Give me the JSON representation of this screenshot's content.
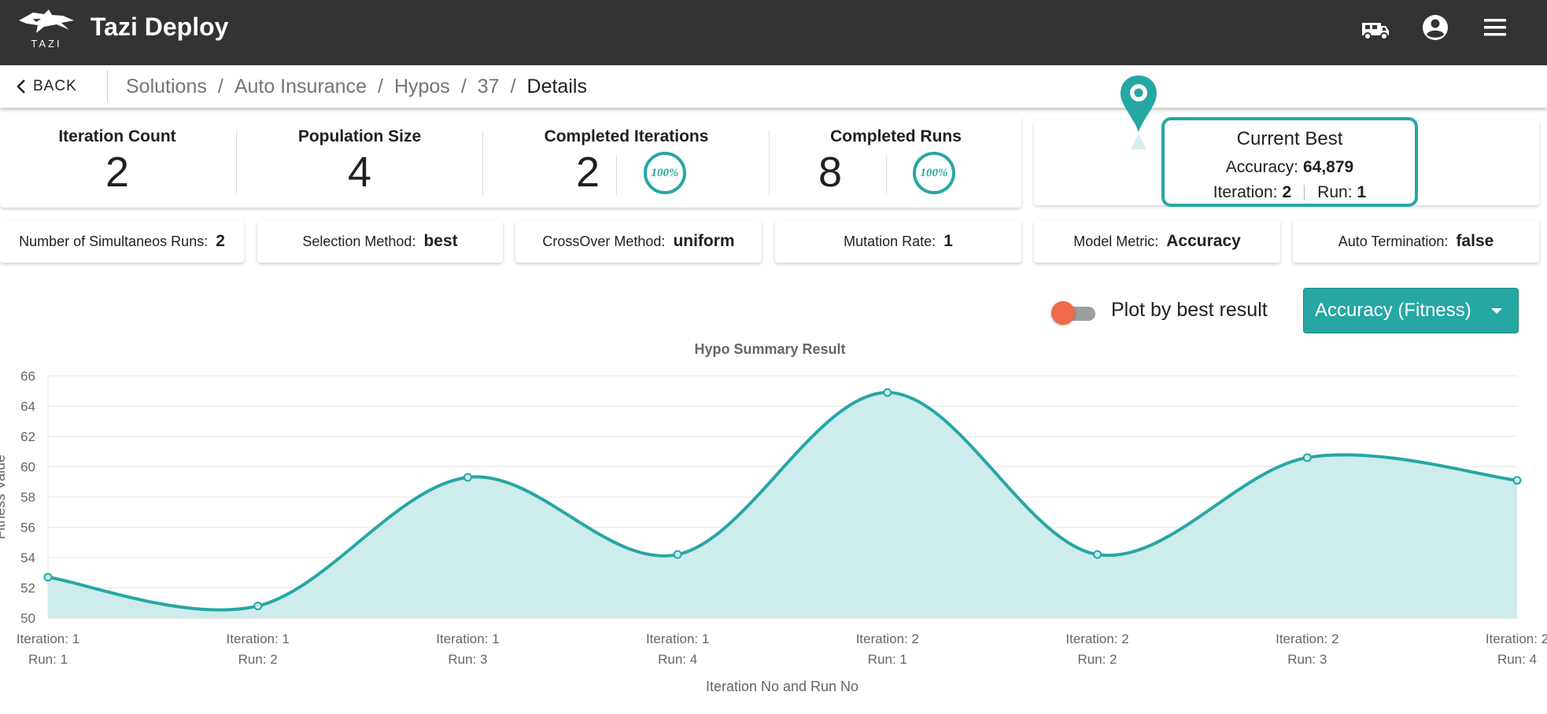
{
  "app": {
    "logo_text": "TAZI",
    "title": "Tazi Deploy"
  },
  "topbar": {
    "icons": [
      "truck-icon",
      "account-circle-icon",
      "menu-icon"
    ]
  },
  "nav": {
    "back_label": "BACK"
  },
  "breadcrumb": {
    "items": [
      "Solutions",
      "Auto Insurance",
      "Hypos",
      "37",
      "Details"
    ]
  },
  "stats": {
    "iteration_count": {
      "label": "Iteration Count",
      "value": "2"
    },
    "population_size": {
      "label": "Population Size",
      "value": "4"
    },
    "completed_iterations": {
      "label": "Completed Iterations",
      "value": "2",
      "progress_label": "100%",
      "progress": 100
    },
    "completed_runs": {
      "label": "Completed Runs",
      "value": "8",
      "progress_label": "100%",
      "progress": 100
    }
  },
  "current_best": {
    "title": "Current Best",
    "accuracy_label": "Accuracy:",
    "accuracy_value": "64,879",
    "iteration_label": "Iteration:",
    "iteration_value": "2",
    "run_label": "Run:",
    "run_value": "1"
  },
  "params": {
    "simultaneous_runs": {
      "label": "Number of Simultaneos Runs:",
      "value": "2"
    },
    "selection_method": {
      "label": "Selection Method:",
      "value": "best"
    },
    "crossover_method": {
      "label": "CrossOver Method:",
      "value": "uniform"
    },
    "mutation_rate": {
      "label": "Mutation Rate:",
      "value": "1"
    },
    "model_metric": {
      "label": "Model Metric:",
      "value": "Accuracy"
    },
    "auto_termination": {
      "label": "Auto Termination:",
      "value": "false"
    }
  },
  "controls": {
    "plot_toggle_label": "Plot by best result",
    "plot_toggle_on": false,
    "metric_dropdown_value": "Accuracy (Fitness)"
  },
  "colors": {
    "accent": "#26a7a4",
    "topbar": "#333333",
    "toggle_thumb": "#ee6a4a",
    "area_fill": "#cdeceb"
  },
  "chart_data": {
    "type": "area",
    "title": "Hypo Summary Result",
    "xlabel": "Iteration No and Run No",
    "ylabel": "Fitness Value",
    "ylim": [
      50,
      66
    ],
    "yticks": [
      50,
      52,
      54,
      56,
      58,
      60,
      62,
      64,
      66
    ],
    "grid": true,
    "categories": [
      [
        "Iteration: 1",
        "Run: 1"
      ],
      [
        "Iteration: 1",
        "Run: 2"
      ],
      [
        "Iteration: 1",
        "Run: 3"
      ],
      [
        "Iteration: 1",
        "Run: 4"
      ],
      [
        "Iteration: 2",
        "Run: 1"
      ],
      [
        "Iteration: 2",
        "Run: 2"
      ],
      [
        "Iteration: 2",
        "Run: 3"
      ],
      [
        "Iteration: 2",
        "Run: 4"
      ]
    ],
    "series": [
      {
        "values": [
          52.7,
          50.8,
          59.3,
          54.2,
          64.9,
          54.2,
          60.6,
          59.1
        ]
      }
    ]
  }
}
